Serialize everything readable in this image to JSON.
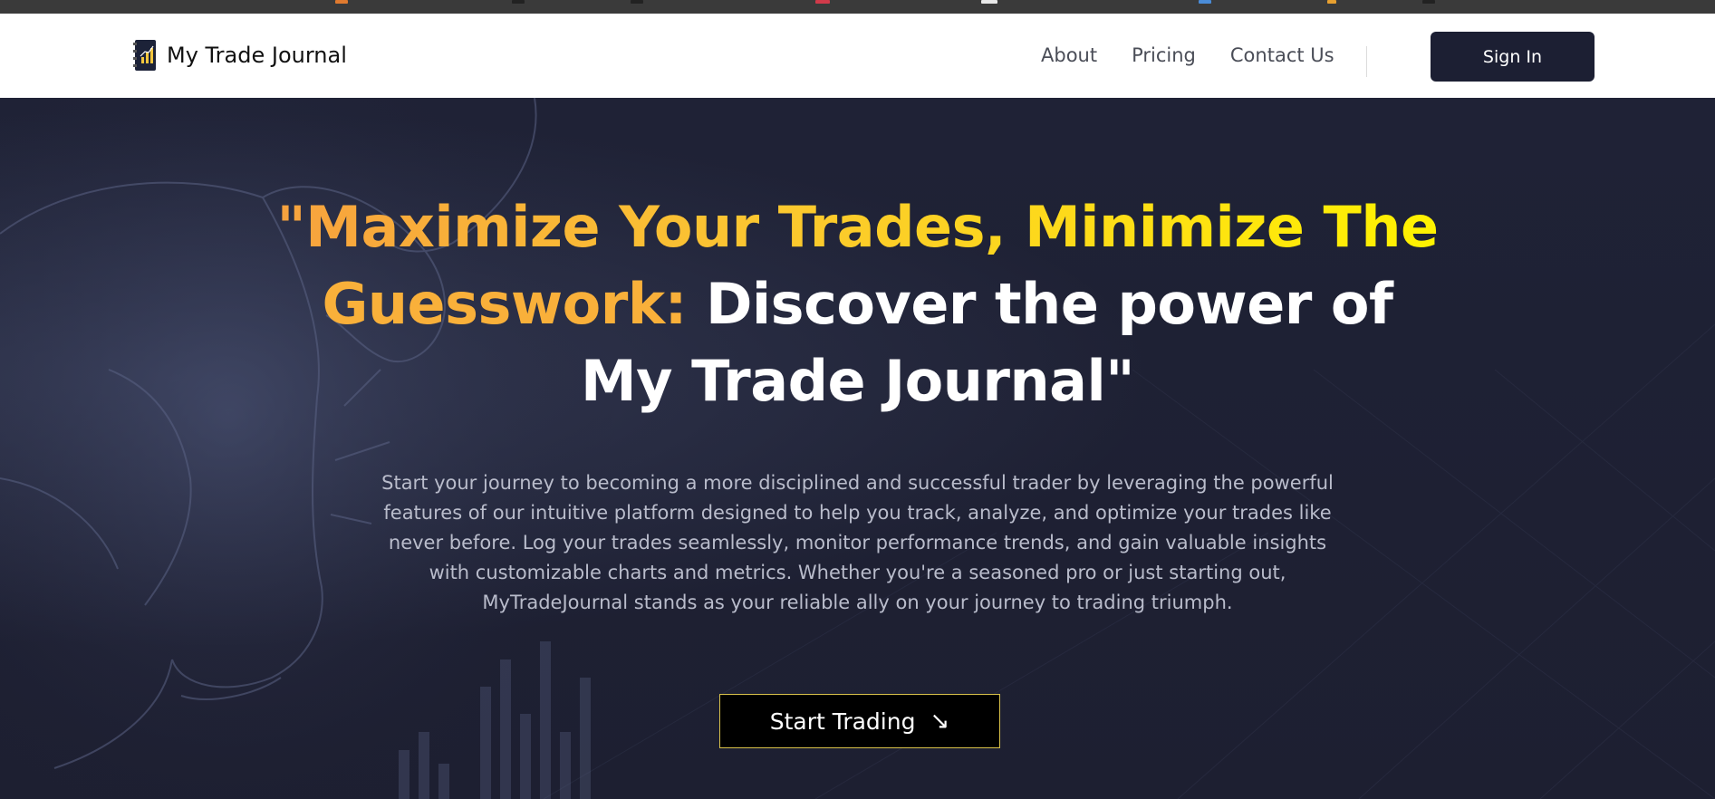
{
  "nav": {
    "brand": "My Trade Journal",
    "links": [
      "About",
      "Pricing",
      "Contact Us"
    ],
    "signin": "Sign In"
  },
  "hero": {
    "headline_part1": "\"Maximize Your Trades, Minimize The",
    "headline_part2": "Guesswork:",
    "headline_part3": " Discover the power of",
    "headline_part4": "My Trade Journal\"",
    "subtext": "Start your journey to becoming a more disciplined and successful trader by leveraging the powerful features of our intuitive platform designed to help you track, analyze, and optimize your trades like never before. Log your trades seamlessly, monitor performance trends, and gain valuable insights with customizable charts and metrics. Whether you're a seasoned pro or just starting out, MyTradeJournal stands as your reliable ally on your journey to trading triumph.",
    "cta_label": "Start Trading",
    "cta_icon": "arrow-down-right-icon",
    "cta_arrow": "↘"
  },
  "colors": {
    "hero_bg": "#1e2033",
    "accent_orange": "#f9b03a",
    "accent_yellow": "#fff200",
    "signin_bg": "#1c1f33",
    "cta_border": "#d8c14a"
  }
}
